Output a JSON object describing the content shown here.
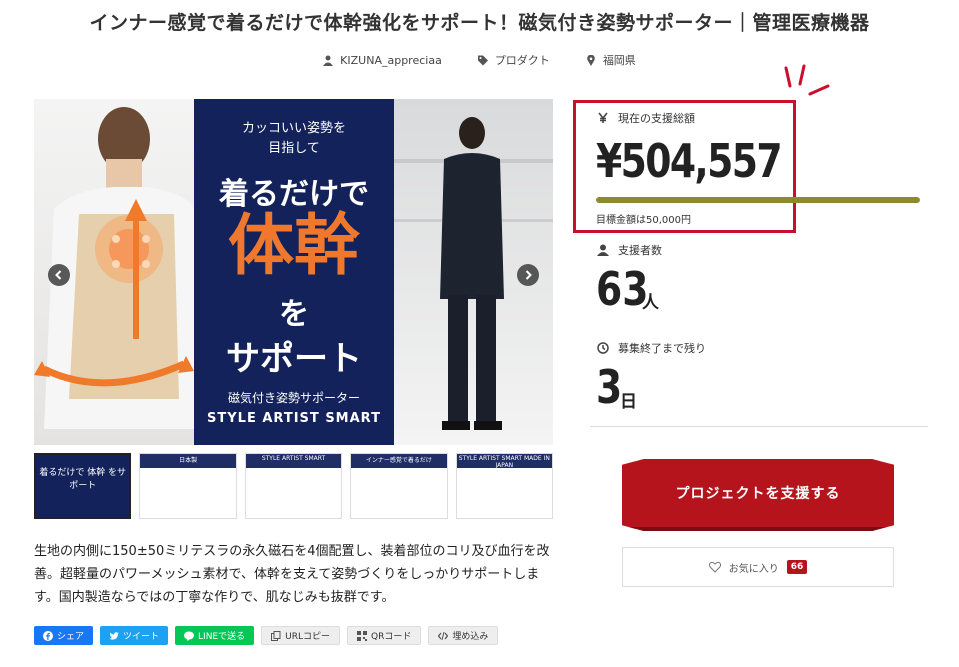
{
  "title": "インナー感覚で着るだけで体幹強化をサポート！磁気付き姿勢サポーター｜管理医療機器",
  "meta": {
    "owner": "KIZUNA_appreciaa",
    "category": "プロダクト",
    "location": "福岡県"
  },
  "slide": {
    "sub1": "カッコいい姿勢を",
    "sub2": "目指して",
    "line1": "着るだけで",
    "line2": "体幹",
    "line3": "を",
    "line4": "サポート",
    "product_jp": "磁気付き姿勢サポーター",
    "product_en": "STYLE ARTIST SMART"
  },
  "thumbs": [
    {
      "label": "着るだけで 体幹 をサポート"
    },
    {
      "label": "日本製"
    },
    {
      "label": "STYLE ARTIST SMART"
    },
    {
      "label": "インナー感覚で着るだけ"
    },
    {
      "label": "STYLE ARTIST SMART MADE IN JAPAN"
    }
  ],
  "description": "生地の内側に150±50ミリテスラの永久磁石を4個配置し、装着部位のコリ及び血行を改善。超軽量のパワーメッシュ素材で、体幹を支えて姿勢づくりをしっかりサポートします。国内製造ならではの丁寧な作りで、肌なじみも抜群です。",
  "share": {
    "facebook": "シェア",
    "twitter": "ツイート",
    "line": "LINEで送る",
    "url": "URLコピー",
    "qr": "QRコード",
    "embed": "埋め込み"
  },
  "stats": {
    "total_label": "現在の支援総額",
    "total_amount": "¥504,557",
    "progress_percent": 100,
    "goal_text": "目標金額は50,000円",
    "backers_label": "支援者数",
    "backers_count": "63",
    "backers_unit": "人",
    "remaining_label": "募集終了まで残り",
    "remaining_count": "3",
    "remaining_unit": "日"
  },
  "cta": {
    "back_label": "プロジェクトを支援する",
    "favorite_label": "お気に入り",
    "favorite_count": "66"
  },
  "colors": {
    "accent_red": "#b5141c",
    "highlight_red": "#c8102e",
    "progress": "#8c8a2c",
    "navy": "#13225a"
  }
}
